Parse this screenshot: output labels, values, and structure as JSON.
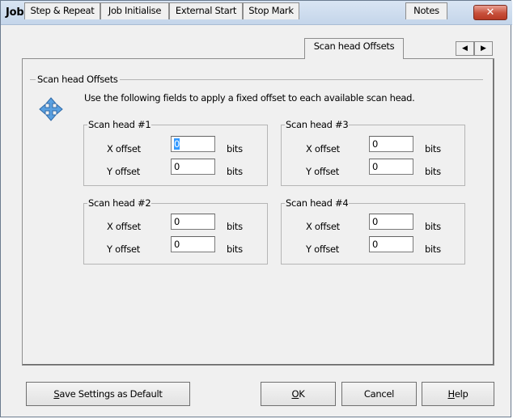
{
  "window": {
    "title": "Job Settings",
    "close_glyph": "✕"
  },
  "tabs": [
    {
      "label": "Step & Repeat"
    },
    {
      "label": "Job Initialise"
    },
    {
      "label": "External Start"
    },
    {
      "label": "Stop Mark"
    },
    {
      "label": "Scan head Offsets",
      "active": true
    },
    {
      "label": "Notes"
    }
  ],
  "tab_scroll": {
    "left_glyph": "◀",
    "right_glyph": "▶"
  },
  "panel": {
    "group_title": "Scan head Offsets",
    "description": "Use the following fields to apply a fixed offset to each available scan head.",
    "icon": "move-arrows-icon",
    "heads": [
      {
        "title": "Scan head #1",
        "x_label": "X offset",
        "x_value": "0",
        "y_label": "Y offset",
        "y_value": "0",
        "unit": "bits"
      },
      {
        "title": "Scan head #2",
        "x_label": "X offset",
        "x_value": "0",
        "y_label": "Y offset",
        "y_value": "0",
        "unit": "bits"
      },
      {
        "title": "Scan head #3",
        "x_label": "X offset",
        "x_value": "0",
        "y_label": "Y offset",
        "y_value": "0",
        "unit": "bits"
      },
      {
        "title": "Scan head #4",
        "x_label": "X offset",
        "x_value": "0",
        "y_label": "Y offset",
        "y_value": "0",
        "unit": "bits"
      }
    ]
  },
  "buttons": {
    "save_default": {
      "mnemonic": "S",
      "rest": "ave Settings as Default"
    },
    "ok": {
      "mnemonic": "O",
      "rest": "K"
    },
    "cancel": "Cancel",
    "help": {
      "mnemonic": "H",
      "rest": "elp"
    }
  },
  "colors": {
    "close_button": "#c7503b",
    "selection": "#3399ff",
    "titlebar": "#c4d5ea"
  }
}
